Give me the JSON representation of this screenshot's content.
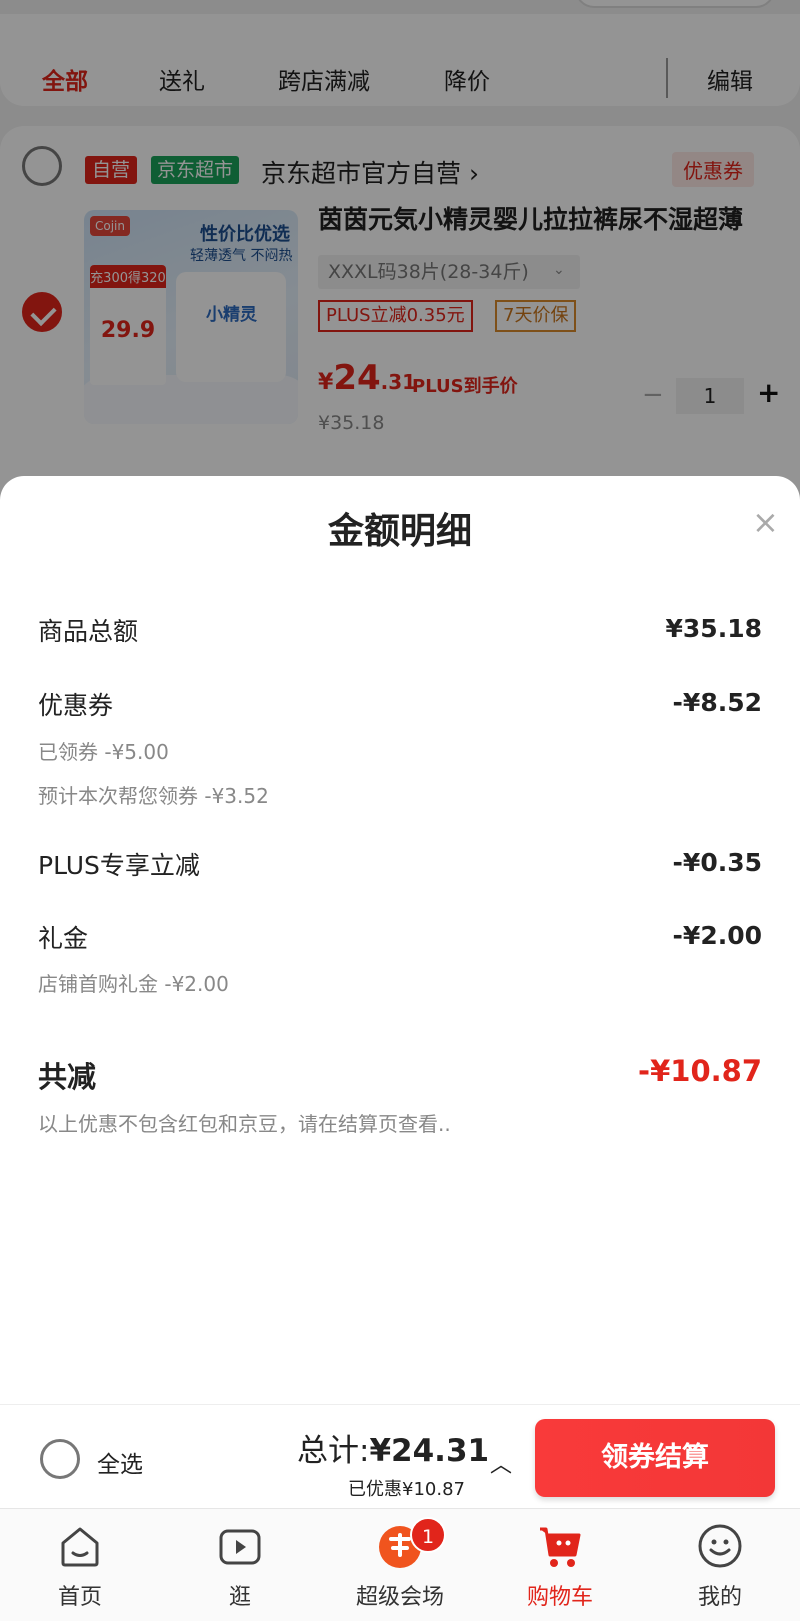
{
  "filter_tabs": {
    "items": [
      "全部",
      "送礼",
      "跨店满减",
      "降价"
    ],
    "edit": "编辑"
  },
  "shop": {
    "badge_self": "自营",
    "badge_jd": "京东超市",
    "name": "京东超市官方自营 ›",
    "coupon_tag": "优惠券"
  },
  "product": {
    "image_text_1": "性价比优选",
    "image_text_2": "轻薄透气 不闷热",
    "image_promo_top": "充300得320",
    "image_promo_price": "29.9",
    "image_pack_text": "小精灵",
    "title": "茵茵元気小精灵婴儿拉拉裤尿不湿超薄",
    "spec": "XXXL码38片(28-34斤)",
    "tag_plus": "PLUS立减0.35元",
    "tag_guarantee": "7天价保",
    "price_symbol": "¥",
    "price_int": "24",
    "price_dec": ".31",
    "price_note": "PLUS到手价",
    "orig_price": "¥35.18",
    "quantity": "1"
  },
  "sheet": {
    "title": "金额明细",
    "rows": [
      {
        "label": "商品总额",
        "value": "¥35.18"
      },
      {
        "label": "优惠券",
        "value": "-¥8.52",
        "subs": [
          "已领券 -¥5.00",
          "预计本次帮您领券 -¥3.52"
        ]
      },
      {
        "label": "PLUS专享立减",
        "value": "-¥0.35"
      },
      {
        "label": "礼金",
        "value": "-¥2.00",
        "subs": [
          "店铺首购礼金 -¥2.00"
        ]
      }
    ],
    "total_label": "共减",
    "total_value": "-¥10.87",
    "note": "以上优惠不包含红包和京豆，请在结算页查看.."
  },
  "checkout": {
    "select_all": "全选",
    "total_prefix": "总计:",
    "total_amount": "¥24.31",
    "saved": "已优惠¥10.87",
    "button": "领券结算"
  },
  "tabbar": {
    "items": [
      {
        "label": "首页",
        "icon": "home-icon"
      },
      {
        "label": "逛",
        "icon": "video-play-icon"
      },
      {
        "label": "超级会场",
        "icon": "super-venue-icon",
        "badge": "1"
      },
      {
        "label": "购物车",
        "icon": "cart-icon",
        "active": true
      },
      {
        "label": "我的",
        "icon": "smiley-profile-icon"
      }
    ]
  },
  "colors": {
    "accent": "#e1251b",
    "jd_green": "#1aa35a",
    "guarantee_orange": "#c8741a"
  }
}
